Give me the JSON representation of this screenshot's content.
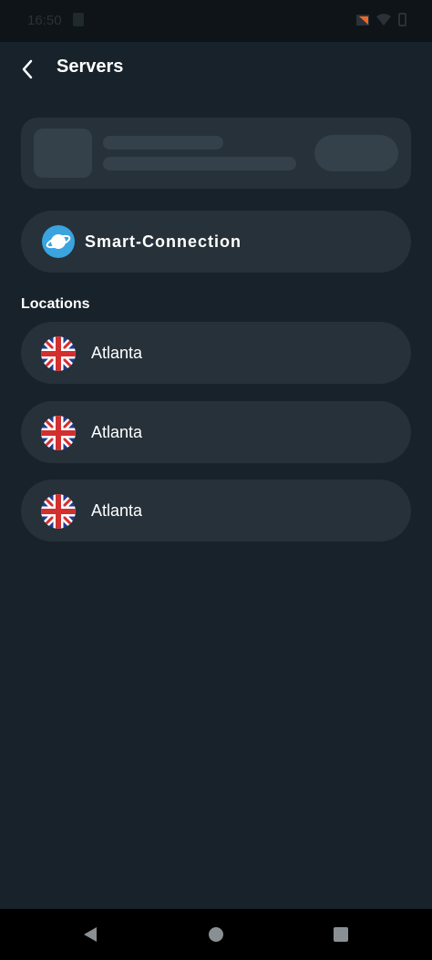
{
  "status_bar": {
    "time": "16:50",
    "icons": [
      "sim-icon",
      "vpn-key-icon",
      "wifi-icon",
      "battery-icon"
    ],
    "vpn_color": "#e8692b"
  },
  "header": {
    "title": "Servers",
    "back_icon": "chevron-left-icon"
  },
  "skeleton_card": {
    "state": "loading"
  },
  "smart_connection": {
    "label": "Smart-Connection",
    "icon": "planet-icon",
    "icon_color": "#3aa3e0"
  },
  "locations": {
    "section_title": "Locations",
    "items": [
      {
        "label": "Atlanta",
        "flag": "uk-flag-icon"
      },
      {
        "label": "Atlanta",
        "flag": "uk-flag-icon"
      },
      {
        "label": "Atlanta",
        "flag": "uk-flag-icon"
      }
    ]
  },
  "navigation_bar": {
    "icons": [
      "nav-back-icon",
      "nav-home-icon",
      "nav-recents-icon"
    ]
  },
  "colors": {
    "background": "#17222a",
    "card": "#263139",
    "skeleton": "#34414a",
    "text": "#ffffff"
  }
}
